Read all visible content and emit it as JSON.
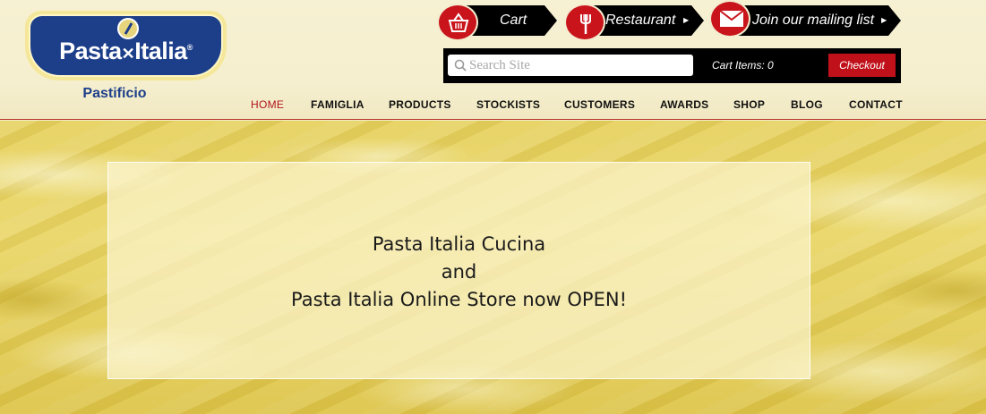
{
  "logo": {
    "wordmark_left": "Pasta",
    "wordmark_right": "Italia",
    "subtitle": "Pastificio"
  },
  "top_links": {
    "cart": "Cart",
    "restaurant": "Restaurant",
    "mailing": "Join our mailing list",
    "arrow": "▶"
  },
  "search": {
    "placeholder": "Search Site"
  },
  "cart_summary": {
    "items_text": "Cart Items: 0",
    "checkout_label": "Checkout"
  },
  "nav": {
    "items": [
      "HOME",
      "FAMIGLIA",
      "PRODUCTS",
      "STOCKISTS",
      "CUSTOMERS",
      "AWARDS",
      "SHOP",
      "BLOG",
      "CONTACT"
    ],
    "active": "HOME"
  },
  "hero": {
    "line1": "Pasta Italia Cucina",
    "line2": "and",
    "line3": "Pasta Italia Online Store now OPEN!"
  },
  "colors": {
    "accent_red": "#c0111a",
    "brand_blue": "#1d3f8a",
    "header_bg": "#f5efcf"
  }
}
